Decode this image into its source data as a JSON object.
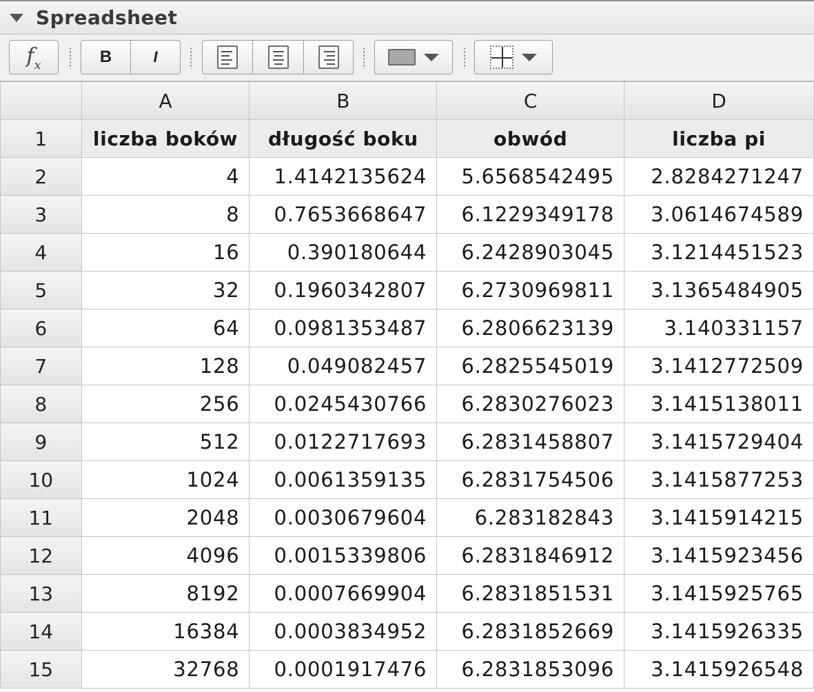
{
  "panel": {
    "title": "Spreadsheet"
  },
  "toolbar": {
    "fx_label": "f",
    "fx_sub": "x",
    "bold_label": "B",
    "italic_label": "I",
    "fill_color": "#a9a9a9"
  },
  "columns": [
    "A",
    "B",
    "C",
    "D"
  ],
  "header_row": {
    "row_number": "1",
    "cells": [
      "liczba boków",
      "długość boku",
      "obwód",
      "liczba pi"
    ]
  },
  "rows": [
    {
      "n": "2",
      "cells": [
        "4",
        "1.4142135624",
        "5.6568542495",
        "2.8284271247"
      ]
    },
    {
      "n": "3",
      "cells": [
        "8",
        "0.7653668647",
        "6.1229349178",
        "3.0614674589"
      ]
    },
    {
      "n": "4",
      "cells": [
        "16",
        "0.390180644",
        "6.2428903045",
        "3.1214451523"
      ]
    },
    {
      "n": "5",
      "cells": [
        "32",
        "0.1960342807",
        "6.2730969811",
        "3.1365484905"
      ]
    },
    {
      "n": "6",
      "cells": [
        "64",
        "0.0981353487",
        "6.2806623139",
        "3.140331157"
      ]
    },
    {
      "n": "7",
      "cells": [
        "128",
        "0.049082457",
        "6.2825545019",
        "3.1412772509"
      ]
    },
    {
      "n": "8",
      "cells": [
        "256",
        "0.0245430766",
        "6.2830276023",
        "3.1415138011"
      ]
    },
    {
      "n": "9",
      "cells": [
        "512",
        "0.0122717693",
        "6.2831458807",
        "3.1415729404"
      ]
    },
    {
      "n": "10",
      "cells": [
        "1024",
        "0.0061359135",
        "6.2831754506",
        "3.1415877253"
      ]
    },
    {
      "n": "11",
      "cells": [
        "2048",
        "0.0030679604",
        "6.283182843",
        "3.1415914215"
      ]
    },
    {
      "n": "12",
      "cells": [
        "4096",
        "0.0015339806",
        "6.2831846912",
        "3.1415923456"
      ]
    },
    {
      "n": "13",
      "cells": [
        "8192",
        "0.0007669904",
        "6.2831851531",
        "3.1415925765"
      ]
    },
    {
      "n": "14",
      "cells": [
        "16384",
        "0.0003834952",
        "6.2831852669",
        "3.1415926335"
      ]
    },
    {
      "n": "15",
      "cells": [
        "32768",
        "0.0001917476",
        "6.2831853096",
        "3.1415926548"
      ]
    }
  ]
}
